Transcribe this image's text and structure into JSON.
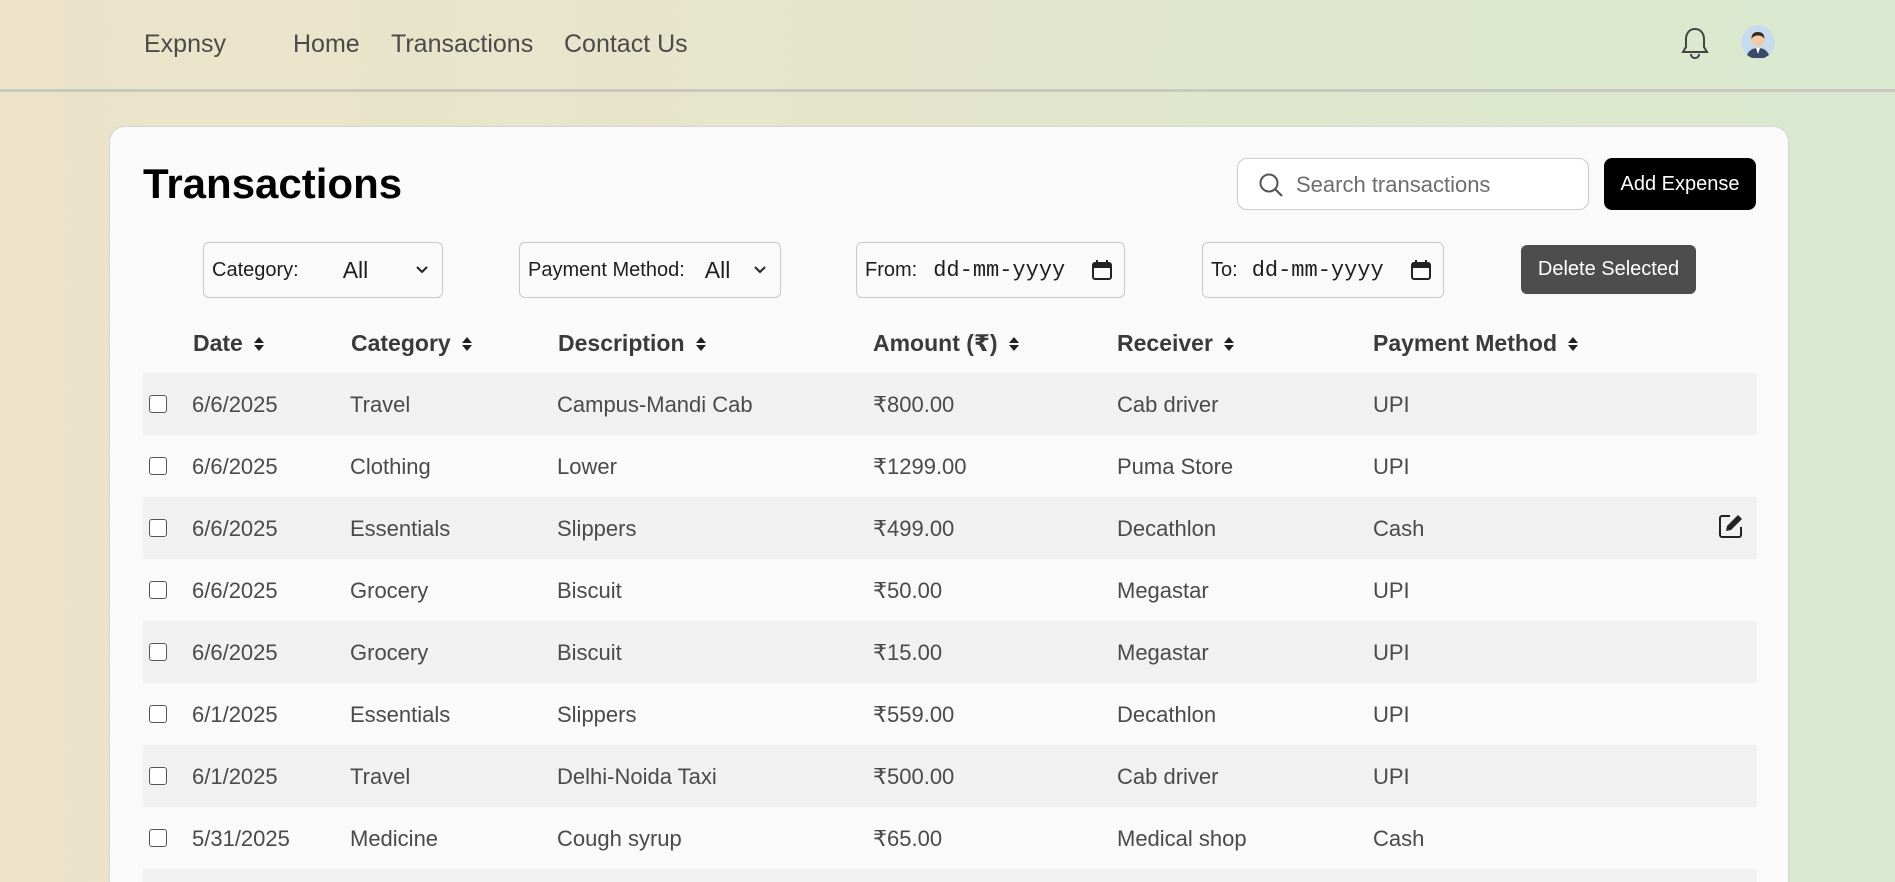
{
  "nav": {
    "brand": "Expnsy",
    "links": [
      "Home",
      "Transactions",
      "Contact Us"
    ]
  },
  "page": {
    "title": "Transactions",
    "search_placeholder": "Search transactions",
    "add_button": "Add Expense",
    "delete_button": "Delete Selected"
  },
  "filters": {
    "category_label": "Category:",
    "category_value": "All",
    "payment_label": "Payment Method:",
    "payment_value": "All",
    "from_label": "From:",
    "to_label": "To:",
    "date_placeholder": "dd-mm-yyyy"
  },
  "table": {
    "headers": [
      "Date",
      "Category",
      "Description",
      "Amount (₹)",
      "Receiver",
      "Payment Method"
    ],
    "rows": [
      {
        "date": "6/6/2025",
        "category": "Travel",
        "description": "Campus-Mandi Cab",
        "amount": "₹800.00",
        "receiver": "Cab driver",
        "method": "UPI"
      },
      {
        "date": "6/6/2025",
        "category": "Clothing",
        "description": "Lower",
        "amount": "₹1299.00",
        "receiver": "Puma Store",
        "method": "UPI"
      },
      {
        "date": "6/6/2025",
        "category": "Essentials",
        "description": "Slippers",
        "amount": "₹499.00",
        "receiver": "Decathlon",
        "method": "Cash"
      },
      {
        "date": "6/6/2025",
        "category": "Grocery",
        "description": "Biscuit",
        "amount": "₹50.00",
        "receiver": "Megastar",
        "method": "UPI"
      },
      {
        "date": "6/6/2025",
        "category": "Grocery",
        "description": "Biscuit",
        "amount": "₹15.00",
        "receiver": "Megastar",
        "method": "UPI"
      },
      {
        "date": "6/1/2025",
        "category": "Essentials",
        "description": "Slippers",
        "amount": "₹559.00",
        "receiver": "Decathlon",
        "method": "UPI"
      },
      {
        "date": "6/1/2025",
        "category": "Travel",
        "description": "Delhi-Noida Taxi",
        "amount": "₹500.00",
        "receiver": "Cab driver",
        "method": "UPI"
      },
      {
        "date": "5/31/2025",
        "category": "Medicine",
        "description": "Cough syrup",
        "amount": "₹65.00",
        "receiver": "Medical shop",
        "method": "Cash"
      }
    ]
  }
}
